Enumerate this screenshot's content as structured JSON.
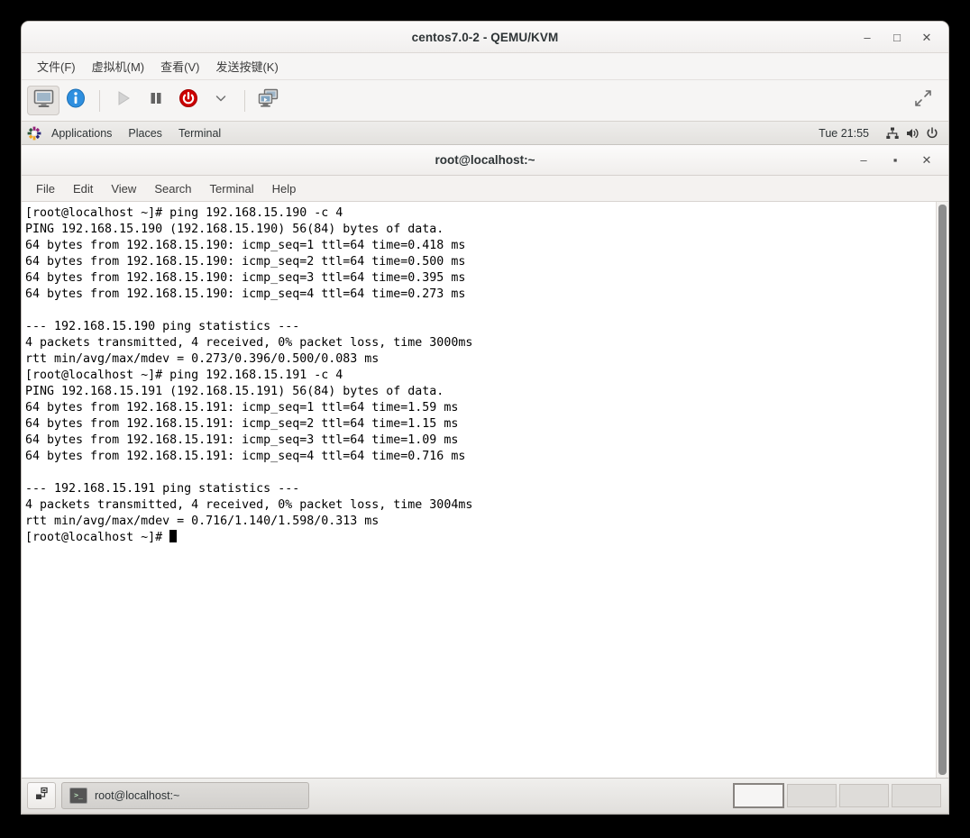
{
  "vm_window": {
    "title": "centos7.0-2 - QEMU/KVM",
    "window_buttons": [
      {
        "name": "minimize",
        "glyph": "–"
      },
      {
        "name": "maximize",
        "glyph": "□"
      },
      {
        "name": "close",
        "glyph": "✕"
      }
    ],
    "menus": [
      {
        "label": "文件(F)",
        "name": "file"
      },
      {
        "label": "虚拟机(M)",
        "name": "virtual-machine"
      },
      {
        "label": "查看(V)",
        "name": "view"
      },
      {
        "label": "发送按键(K)",
        "name": "send-key"
      }
    ],
    "toolbar": [
      {
        "name": "console-view-button",
        "icon": "monitor-icon",
        "state": "active"
      },
      {
        "name": "details-view-button",
        "icon": "info-icon",
        "state": "normal"
      },
      {
        "name": "separator-1",
        "icon": "separator",
        "state": "static"
      },
      {
        "name": "run-button",
        "icon": "play-icon",
        "state": "disabled"
      },
      {
        "name": "pause-button",
        "icon": "pause-icon",
        "state": "normal"
      },
      {
        "name": "shutdown-button",
        "icon": "power-icon",
        "state": "normal"
      },
      {
        "name": "shutdown-menu-button",
        "icon": "chevron-down-icon",
        "state": "normal"
      },
      {
        "name": "separator-2",
        "icon": "separator",
        "state": "static"
      },
      {
        "name": "snapshots-button",
        "icon": "screens-icon",
        "state": "normal"
      },
      {
        "name": "fullscreen-button",
        "icon": "fullscreen-icon",
        "state": "normal"
      }
    ]
  },
  "guest": {
    "top_panel": {
      "logo_icon": "centos-logo-icon",
      "menus": [
        {
          "label": "Applications",
          "name": "applications"
        },
        {
          "label": "Places",
          "name": "places"
        },
        {
          "label": "Terminal",
          "name": "terminal"
        }
      ],
      "clock": "Tue 21:55",
      "tray_icons": [
        {
          "name": "network-icon"
        },
        {
          "name": "volume-icon"
        },
        {
          "name": "power-icon"
        }
      ]
    },
    "terminal_window": {
      "title": "root@localhost:~",
      "window_buttons": [
        {
          "name": "minimize",
          "glyph": "–"
        },
        {
          "name": "maximize",
          "glyph": "▪"
        },
        {
          "name": "close",
          "glyph": "✕"
        }
      ],
      "menus": [
        {
          "label": "File",
          "name": "file"
        },
        {
          "label": "Edit",
          "name": "edit"
        },
        {
          "label": "View",
          "name": "view"
        },
        {
          "label": "Search",
          "name": "search"
        },
        {
          "label": "Terminal",
          "name": "terminal"
        },
        {
          "label": "Help",
          "name": "help"
        }
      ],
      "lines": [
        "[root@localhost ~]# ping 192.168.15.190 -c 4",
        "PING 192.168.15.190 (192.168.15.190) 56(84) bytes of data.",
        "64 bytes from 192.168.15.190: icmp_seq=1 ttl=64 time=0.418 ms",
        "64 bytes from 192.168.15.190: icmp_seq=2 ttl=64 time=0.500 ms",
        "64 bytes from 192.168.15.190: icmp_seq=3 ttl=64 time=0.395 ms",
        "64 bytes from 192.168.15.190: icmp_seq=4 ttl=64 time=0.273 ms",
        "",
        "--- 192.168.15.190 ping statistics ---",
        "4 packets transmitted, 4 received, 0% packet loss, time 3000ms",
        "rtt min/avg/max/mdev = 0.273/0.396/0.500/0.083 ms",
        "[root@localhost ~]# ping 192.168.15.191 -c 4",
        "PING 192.168.15.191 (192.168.15.191) 56(84) bytes of data.",
        "64 bytes from 192.168.15.191: icmp_seq=1 ttl=64 time=1.59 ms",
        "64 bytes from 192.168.15.191: icmp_seq=2 ttl=64 time=1.15 ms",
        "64 bytes from 192.168.15.191: icmp_seq=3 ttl=64 time=1.09 ms",
        "64 bytes from 192.168.15.191: icmp_seq=4 ttl=64 time=0.716 ms",
        "",
        "--- 192.168.15.191 ping statistics ---",
        "4 packets transmitted, 4 received, 0% packet loss, time 3004ms",
        "rtt min/avg/max/mdev = 0.716/1.140/1.598/0.313 ms"
      ],
      "prompt": "[root@localhost ~]# "
    },
    "taskbar": {
      "show_desktop_icon": "show-desktop-icon",
      "task_label": "root@localhost:~",
      "task_icon": "terminal-icon",
      "workspaces": [
        {
          "name": "workspace-1",
          "active": true
        },
        {
          "name": "workspace-2",
          "active": false
        },
        {
          "name": "workspace-3",
          "active": false
        },
        {
          "name": "workspace-4",
          "active": false
        }
      ]
    }
  },
  "colors": {
    "chrome_bg": "#f6f5f4",
    "terminal_bg": "#ffffff",
    "terminal_fg": "#000000",
    "power_red": "#cc0000",
    "info_blue": "#2e8fdf"
  }
}
